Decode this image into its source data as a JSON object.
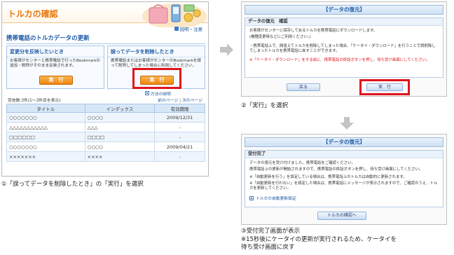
{
  "panel1": {
    "title": "トルカの確認",
    "help_link": "説明・注意",
    "section_title": "携帯電話のトルカデータの更新",
    "box_reflect": {
      "heading": "変更分を反映したいとき",
      "text": "お客様がセンターと携帯電話で行ったBookmarkの追加・削除がそのまま反映されます。",
      "button": "実　行"
    },
    "box_restore": {
      "heading": "誤ってデータを削除したとき",
      "text": "携帯電話またはお客様がセンターのBookmarkを誤って削除してしまった場合に利用してください。",
      "button": "実　行"
    },
    "method_link": "方法の説明",
    "count": "受信数:3件(1～3件目を表示)",
    "pager": {
      "prev": "前のページ",
      "sep": "|",
      "next": "次のページ"
    },
    "table": {
      "headers": [
        "タイトル",
        "インデックス",
        "有効期限"
      ],
      "rows": [
        [
          "○○○○○○○",
          "○○○○",
          "2009/12/31"
        ],
        [
          "△△△△△△△△△△△",
          "△△△",
          "-"
        ],
        [
          "□□□□□□",
          "□□□□",
          "-"
        ],
        [
          "○○○○○○○",
          "○○○○",
          "2009/04/21"
        ],
        [
          "×××××××",
          "××××",
          "-"
        ]
      ]
    }
  },
  "panel2": {
    "header": "【データの復元】",
    "label": "データの復元　確認",
    "text1": "お客様がセンターに保存してあるトルカを携帯電話にダウンロードします。",
    "text2": "(機種変更時などにご利用ください。)",
    "text3": "・携帯電話上で、間違えてトルカを削除してしまった場合、「ケータイ・ダウンロード」を行うことで誤削除してしまったトルカを携帯電話に戻すことができます。",
    "warning": "※「ケータイ・ダウンロード」をする前に、携帯電話の終話ボタンを押し、待ち受け画面にしてください。",
    "back_button": "戻る",
    "exec_button": "実　行"
  },
  "panel3": {
    "header": "【データの復元】",
    "label": "受付完了",
    "text1": "データの復元を受け付けました。携帯電話をご確認ください。",
    "text2": "携帯電話上の更新が開始されますので、携帯電話の終話ボタンを押し、待ち受け画面にしてください。",
    "text3": "※「自動更新を行う」を設定している場合は、携帯電話上のトルカは自動的に更新されます。",
    "text4": "※「自動更新を行わない」を設定した場合は、携帯電話にメッセージが表示されますので、ご確認のうえ、トルカを更新してください。",
    "link": "トルカの自動更新設定",
    "button": "トルカの確認へ"
  },
  "captions": {
    "step1": "①「誤ってデータを削除したとき」の「実行」を選択",
    "step2": "②「実行」を選択",
    "step3_line1": "③受付完了画面が表示",
    "step3_line2": "※15秒後にケータイの更新が実行されるため、ケータイを",
    "step3_line3": "待ち受け画面に戻す"
  },
  "icons": [
    "help-icon",
    "link-icon",
    "arrow-right-icon",
    "arrow-down-icon"
  ],
  "colors": {
    "title_orange": "#e8780c",
    "heading_blue": "#1f5aa6",
    "highlight_red": "#e0141c",
    "button_orange": "#f39a21"
  }
}
